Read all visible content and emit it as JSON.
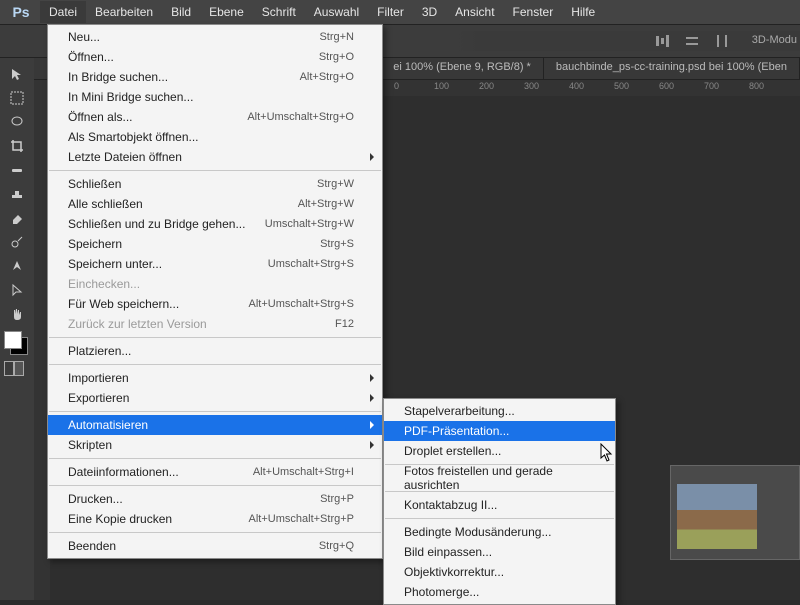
{
  "menubar": {
    "items": [
      "Datei",
      "Bearbeiten",
      "Bild",
      "Ebene",
      "Schrift",
      "Auswahl",
      "Filter",
      "3D",
      "Ansicht",
      "Fenster",
      "Hilfe"
    ]
  },
  "optionsbar": {
    "mode3d": "3D-Modu"
  },
  "tabs": {
    "t1": "ei 100% (Ebene 9, RGB/8) *",
    "t2": "bauchbinde_ps-cc-training.psd bei 100% (Eben"
  },
  "ruler": {
    "r0": "0",
    "r100": "100",
    "r200": "200",
    "r300": "300",
    "r400": "400",
    "r500": "500",
    "r600": "600",
    "r700": "700",
    "r800": "800"
  },
  "menu_datei": {
    "neu": {
      "l": "Neu...",
      "k": "Strg+N"
    },
    "oeffnen": {
      "l": "Öffnen...",
      "k": "Strg+O"
    },
    "bridge": {
      "l": "In Bridge suchen...",
      "k": "Alt+Strg+O"
    },
    "minibridge": {
      "l": "In Mini Bridge suchen..."
    },
    "oeffnenals": {
      "l": "Öffnen als...",
      "k": "Alt+Umschalt+Strg+O"
    },
    "smartobj": {
      "l": "Als Smartobjekt öffnen..."
    },
    "letzte": {
      "l": "Letzte Dateien öffnen"
    },
    "schliessen": {
      "l": "Schließen",
      "k": "Strg+W"
    },
    "alleschl": {
      "l": "Alle schließen",
      "k": "Alt+Strg+W"
    },
    "schlbridge": {
      "l": "Schließen und zu Bridge gehen...",
      "k": "Umschalt+Strg+W"
    },
    "speichern": {
      "l": "Speichern",
      "k": "Strg+S"
    },
    "speichunter": {
      "l": "Speichern unter...",
      "k": "Umschalt+Strg+S"
    },
    "einchecken": {
      "l": "Einchecken..."
    },
    "fuerweb": {
      "l": "Für Web speichern...",
      "k": "Alt+Umschalt+Strg+S"
    },
    "zurueck": {
      "l": "Zurück zur letzten Version",
      "k": "F12"
    },
    "platzieren": {
      "l": "Platzieren..."
    },
    "import": {
      "l": "Importieren"
    },
    "export": {
      "l": "Exportieren"
    },
    "auto": {
      "l": "Automatisieren"
    },
    "skripten": {
      "l": "Skripten"
    },
    "dateiinfo": {
      "l": "Dateiinformationen...",
      "k": "Alt+Umschalt+Strg+I"
    },
    "drucken": {
      "l": "Drucken...",
      "k": "Strg+P"
    },
    "einekopie": {
      "l": "Eine Kopie drucken",
      "k": "Alt+Umschalt+Strg+P"
    },
    "beenden": {
      "l": "Beenden",
      "k": "Strg+Q"
    }
  },
  "menu_auto": {
    "stapel": "Stapelverarbeitung...",
    "pdf": "PDF-Präsentation...",
    "droplet": "Droplet erstellen...",
    "fotos": "Fotos freistellen und gerade ausrichten",
    "kontakt": "Kontaktabzug II...",
    "modus": "Bedingte Modusänderung...",
    "bild": "Bild einpassen...",
    "objektiv": "Objektivkorrektur...",
    "photomerge": "Photomerge..."
  }
}
